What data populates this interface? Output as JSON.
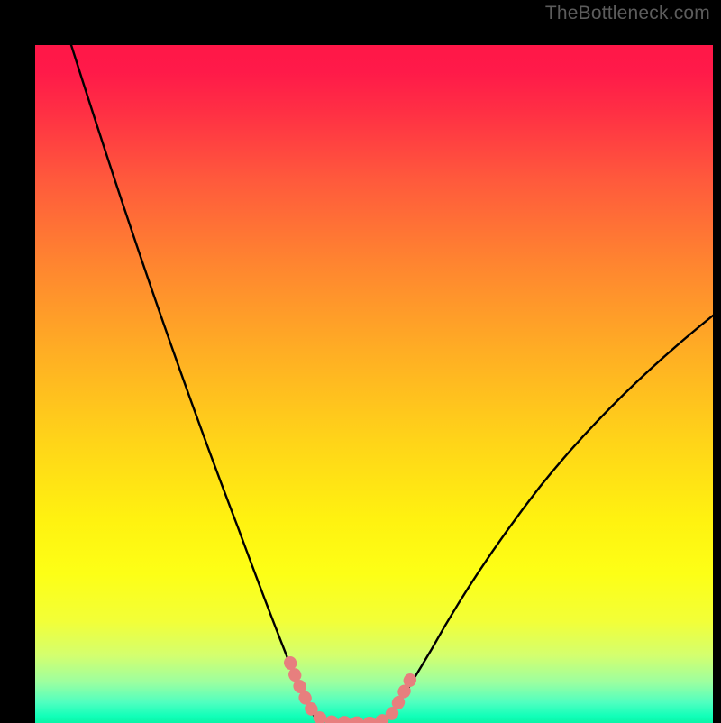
{
  "watermark": {
    "text": "TheBottleneck.com"
  },
  "colors": {
    "background": "#000000",
    "curve_stroke": "#000000",
    "highlight_stroke": "#e77f7e",
    "watermark_color": "#5c5c5c",
    "gradient_top": "#ff1748",
    "gradient_bottom": "#09f5a6"
  },
  "chart_data": {
    "type": "line",
    "title": "",
    "xlabel": "",
    "ylabel": "",
    "xlim": [
      0,
      100
    ],
    "ylim": [
      0,
      100
    ],
    "grid": false,
    "series": [
      {
        "name": "bottleneck-curve",
        "x": [
          0,
          5,
          10,
          15,
          20,
          25,
          30,
          33,
          35,
          37,
          40,
          42,
          44,
          46,
          48,
          50,
          53,
          56,
          60,
          65,
          70,
          75,
          80,
          85,
          90,
          95,
          100
        ],
        "values": [
          100,
          91,
          81,
          71,
          61,
          50,
          38,
          29,
          22,
          15,
          6,
          2,
          0,
          0,
          0,
          1,
          5,
          11,
          19,
          27,
          34,
          40,
          46,
          50,
          54,
          57,
          60
        ]
      }
    ],
    "annotations": [
      {
        "name": "optimal-range-highlight",
        "x_range": [
          37,
          53
        ],
        "note": "thick pink segment near trough of curve"
      }
    ]
  }
}
